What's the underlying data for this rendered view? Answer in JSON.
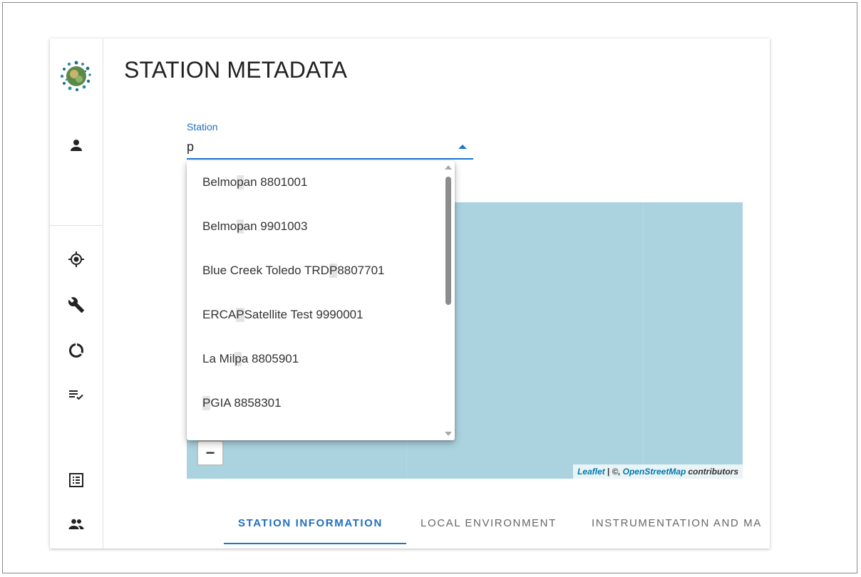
{
  "page": {
    "title": "STATION METADATA"
  },
  "station_field": {
    "label": "Station",
    "value": "p"
  },
  "station_options": [
    {
      "before": "Belmo",
      "match": "p",
      "after": "an 8801001"
    },
    {
      "before": "Belmo",
      "match": "p",
      "after": "an 9901003"
    },
    {
      "before": "Blue Creek Toledo TRD",
      "match": "P",
      "after": " 8807701"
    },
    {
      "before": "ERCA",
      "match": "P",
      "after": " Satellite Test 9990001"
    },
    {
      "before": "La Mil",
      "match": "p",
      "after": "a 8805901"
    },
    {
      "before": "",
      "match": "P",
      "after": "GIA 8858301"
    }
  ],
  "map": {
    "zoom_out_label": "−",
    "attribution": {
      "leaflet": "Leaflet",
      "separator": "| ©,",
      "osm": "OpenStreetMap",
      "suffix": "contributors"
    }
  },
  "tabs": [
    {
      "label": "STATION INFORMATION",
      "active": true
    },
    {
      "label": "LOCAL ENVIRONMENT",
      "active": false
    },
    {
      "label": "INSTRUMENTATION AND MA",
      "active": false
    }
  ],
  "sidebar": {
    "items": [
      {
        "icon": "person-icon"
      },
      {
        "icon": "location-target-icon"
      },
      {
        "icon": "wrench-icon"
      },
      {
        "icon": "circle-progress-icon"
      },
      {
        "icon": "checklist-icon"
      },
      {
        "icon": "list-alt-icon"
      },
      {
        "icon": "group-icon"
      }
    ]
  },
  "colors": {
    "accent": "#1976d2",
    "map_water": "#aad3df",
    "highlight": "#e4e4e4"
  }
}
